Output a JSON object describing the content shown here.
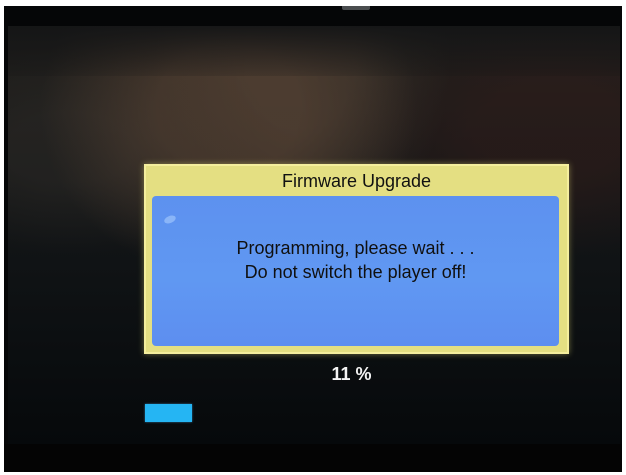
{
  "firmware_upgrade": {
    "title": "Firmware Upgrade",
    "message_line_1": "Programming, please wait . . .",
    "message_line_2": "Do not switch the player off!",
    "progress_percent": 11,
    "progress_label": "11 %"
  },
  "colors": {
    "dialog_border": "#e4df82",
    "dialog_body": "#5f94f1",
    "progress_fill": "#25b5f3",
    "screen_background": "#101315"
  }
}
